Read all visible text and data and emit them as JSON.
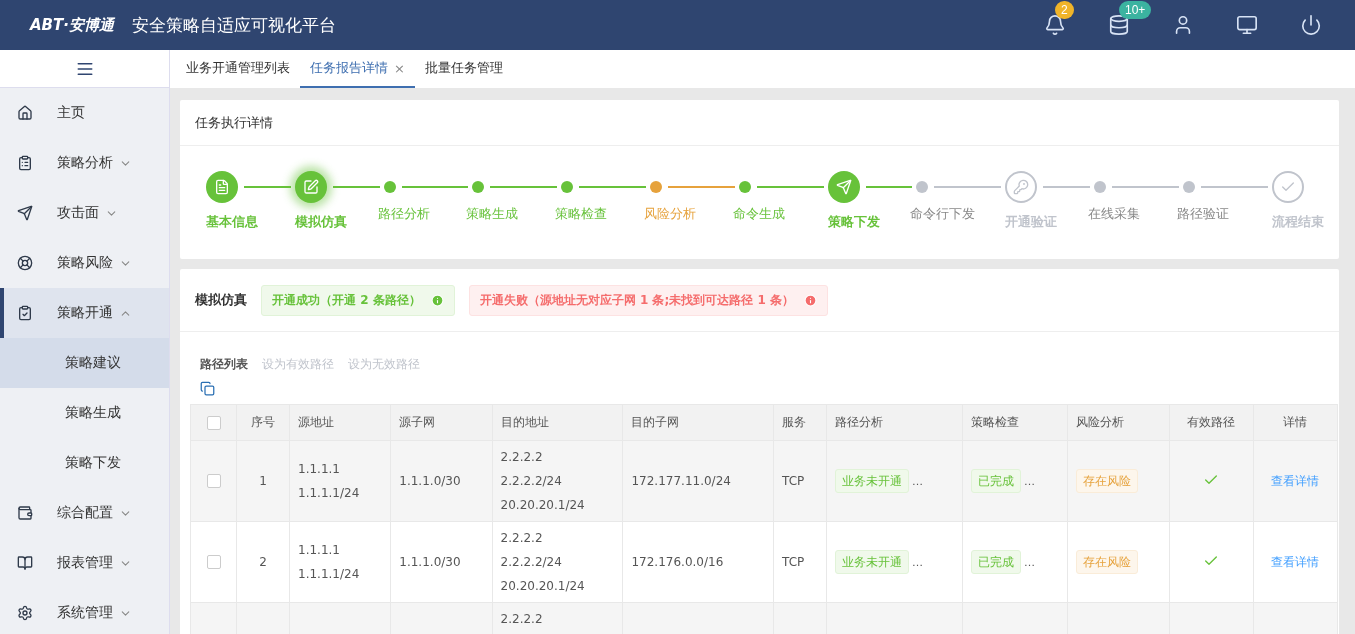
{
  "header": {
    "logo": "ABT·安博通",
    "title": "安全策略自适应可视化平台",
    "actions": [
      {
        "kind": "alert",
        "badge": "2",
        "color": "#f0b429"
      },
      {
        "kind": "database",
        "badge": "10+",
        "color": "#3bb3a0"
      },
      {
        "kind": "user"
      },
      {
        "kind": "monitor"
      },
      {
        "kind": "power"
      }
    ]
  },
  "sidebar": {
    "items": [
      {
        "label": "主页",
        "expandable": false,
        "selected": false
      },
      {
        "label": "策略分析",
        "expandable": true,
        "expanded": false,
        "selected": false
      },
      {
        "label": "攻击面",
        "expandable": true,
        "expanded": false,
        "selected": false
      },
      {
        "label": "策略风险",
        "expandable": true,
        "expanded": false,
        "selected": false
      },
      {
        "label": "策略开通",
        "expandable": true,
        "expanded": true,
        "selected": true,
        "children": [
          {
            "label": "策略建议",
            "selected": true
          },
          {
            "label": "策略生成",
            "selected": false
          },
          {
            "label": "策略下发",
            "selected": false
          }
        ]
      },
      {
        "label": "综合配置",
        "expandable": true,
        "expanded": false,
        "selected": false
      },
      {
        "label": "报表管理",
        "expandable": true,
        "expanded": false,
        "selected": false
      },
      {
        "label": "系统管理",
        "expandable": true,
        "expanded": false,
        "selected": false
      }
    ]
  },
  "tabs": [
    {
      "label": "业务开通管理列表",
      "selected": false,
      "closable": false
    },
    {
      "label": "任务报告详情",
      "selected": true,
      "closable": true,
      "close": "×"
    },
    {
      "label": "批量任务管理",
      "selected": false,
      "closable": false
    }
  ],
  "progress": {
    "title": "任务执行详情",
    "steps": [
      {
        "label": "基本信息",
        "kind": "doc",
        "completed": true,
        "selected": false,
        "warning": false
      },
      {
        "label": "模拟仿真",
        "kind": "sim",
        "completed": true,
        "selected": true,
        "warning": false
      },
      {
        "label": "路径分析",
        "kind": "dot",
        "completed": true,
        "selected": false,
        "warning": false
      },
      {
        "label": "策略生成",
        "kind": "dot",
        "completed": true,
        "selected": false,
        "warning": false
      },
      {
        "label": "策略检查",
        "kind": "dot",
        "completed": true,
        "selected": false,
        "warning": false
      },
      {
        "label": "风险分析",
        "kind": "dot",
        "completed": true,
        "selected": false,
        "warning": true
      },
      {
        "label": "命令生成",
        "kind": "dot",
        "completed": true,
        "selected": false,
        "warning": false
      },
      {
        "label": "策略下发",
        "kind": "send",
        "completed": true,
        "selected": false,
        "warning": false
      },
      {
        "label": "命令行下发",
        "kind": "dot",
        "completed": false,
        "selected": false,
        "warning": false
      },
      {
        "label": "开通验证",
        "kind": "key",
        "completed": false,
        "selected": false,
        "warning": false
      },
      {
        "label": "在线采集",
        "kind": "dot",
        "completed": false,
        "selected": false,
        "warning": false
      },
      {
        "label": "路径验证",
        "kind": "dot",
        "completed": false,
        "selected": false,
        "warning": false
      },
      {
        "label": "流程结束",
        "kind": "end",
        "completed": false,
        "selected": false,
        "warning": false
      }
    ]
  },
  "simulation": {
    "title": "模拟仿真",
    "alerts": [
      {
        "kind": "success",
        "text": "开通成功（开通 2 条路径）"
      },
      {
        "kind": "error",
        "text": "开通失败（源地址无对应子网 1 条;未找到可达路径 1 条）"
      }
    ],
    "toolbar": {
      "title": "路径列表",
      "actions": [
        {
          "label": "设为有效路径",
          "disabled": true
        },
        {
          "label": "设为无效路径",
          "disabled": true
        }
      ]
    },
    "table": {
      "all_checked": false,
      "columns": [
        "序号",
        "源地址",
        "源子网",
        "目的地址",
        "目的子网",
        "服务",
        "路径分析",
        "策略检查",
        "风险分析",
        "有效路径",
        "详情"
      ],
      "rows": [
        {
          "checked": false,
          "index": "1",
          "src": [
            "1.1.1.1",
            "1.1.1.1/24"
          ],
          "src_subnet": "1.1.1.0/30",
          "dst": [
            "2.2.2.2",
            "2.2.2.2/24",
            "20.20.20.1/24"
          ],
          "dst_subnet": "172.177.11.0/24",
          "service": "TCP",
          "path": {
            "text": "业务未开通",
            "kind": "success",
            "more": "…"
          },
          "check": {
            "text": "已完成",
            "kind": "success",
            "more": "…"
          },
          "risk": {
            "text": "存在风险",
            "kind": "warning"
          },
          "valid": true,
          "detail": "查看详情"
        },
        {
          "checked": false,
          "index": "2",
          "src": [
            "1.1.1.1",
            "1.1.1.1/24"
          ],
          "src_subnet": "1.1.1.0/30",
          "dst": [
            "2.2.2.2",
            "2.2.2.2/24",
            "20.20.20.1/24"
          ],
          "dst_subnet": "172.176.0.0/16",
          "service": "TCP",
          "path": {
            "text": "业务未开通",
            "kind": "success",
            "more": "…"
          },
          "check": {
            "text": "已完成",
            "kind": "success",
            "more": "…"
          },
          "risk": {
            "text": "存在风险",
            "kind": "warning"
          },
          "valid": true,
          "detail": "查看详情"
        },
        {
          "dst": [
            "2.2.2.2"
          ]
        }
      ]
    }
  }
}
